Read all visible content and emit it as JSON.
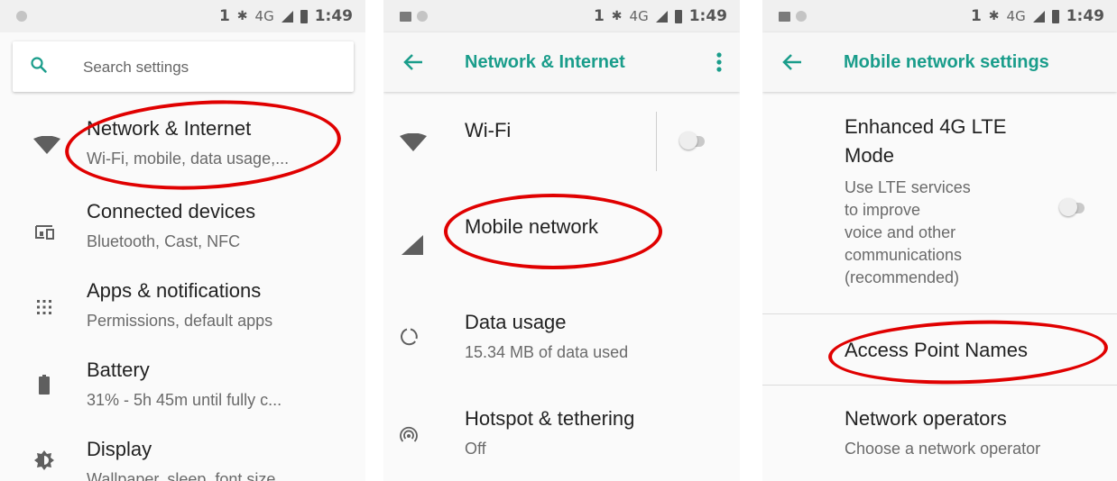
{
  "status_bar": {
    "sim": "1",
    "bluetooth": "✱",
    "network": "4G",
    "time": "1:49"
  },
  "screen1": {
    "search_placeholder": "Search settings",
    "items": [
      {
        "title": "Network & Internet",
        "subtitle": "Wi-Fi, mobile, data usage,..."
      },
      {
        "title": "Connected devices",
        "subtitle": "Bluetooth, Cast, NFC"
      },
      {
        "title": "Apps & notifications",
        "subtitle": "Permissions, default apps"
      },
      {
        "title": "Battery",
        "subtitle": "31% - 5h 45m until fully c..."
      },
      {
        "title": "Display",
        "subtitle": "Wallpaper, sleep, font size"
      }
    ]
  },
  "screen2": {
    "title": "Network & Internet",
    "items": [
      {
        "title": "Wi-Fi",
        "subtitle": ""
      },
      {
        "title": "Mobile network",
        "subtitle": ""
      },
      {
        "title": "Data usage",
        "subtitle": "15.34 MB of data used"
      },
      {
        "title": "Hotspot & tethering",
        "subtitle": "Off"
      }
    ],
    "wifi_toggle_on": false
  },
  "screen3": {
    "title": "Mobile network settings",
    "lte": {
      "title_line1": "Enhanced 4G LTE",
      "title_line2": "Mode",
      "desc_lines": [
        "Use LTE services",
        "to improve",
        "voice and other",
        "communications",
        "(recommended)"
      ],
      "toggle_on": false
    },
    "apn": {
      "title": "Access Point Names"
    },
    "operators": {
      "title": "Network operators",
      "subtitle": "Choose a network operator"
    }
  },
  "colors": {
    "accent": "#1a9d8b",
    "highlight": "#e00000",
    "icon": "#5f5f5f"
  }
}
